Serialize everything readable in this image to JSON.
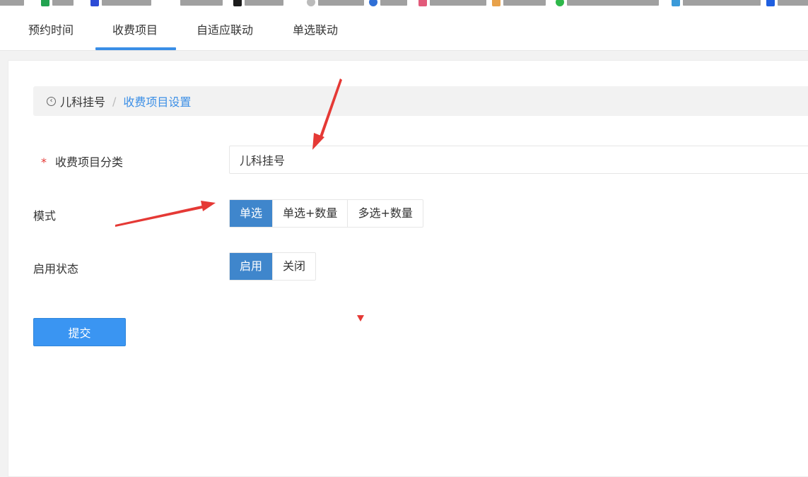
{
  "tabs": [
    {
      "label": "预约时间"
    },
    {
      "label": "收费项目"
    },
    {
      "label": "自适应联动"
    },
    {
      "label": "单选联动"
    }
  ],
  "active_tab": "收费项目",
  "breadcrumb": {
    "parent": "儿科挂号",
    "separator": "/",
    "current": "收费项目设置"
  },
  "form": {
    "category": {
      "required_mark": "*",
      "label": "收费项目分类",
      "value": "儿科挂号"
    },
    "mode": {
      "label": "模式",
      "options": [
        "单选",
        "单选+数量",
        "多选+数量"
      ],
      "selected": "单选"
    },
    "status": {
      "label": "启用状态",
      "options": [
        "启用",
        "关闭"
      ],
      "selected": "启用"
    },
    "submit_label": "提交"
  },
  "colors": {
    "accent": "#3a8ee6",
    "selected_segment": "#3f86cc",
    "submit": "#3a95f2",
    "annotation_arrow": "#e53935"
  }
}
